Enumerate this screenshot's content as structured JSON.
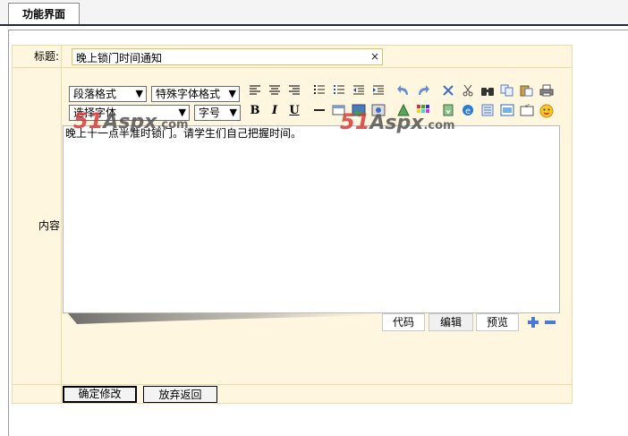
{
  "tab": {
    "label": "功能界面"
  },
  "form": {
    "title_label": "标题:",
    "title_value": "晚上锁门时间通知",
    "content_label": "内容",
    "clear_symbol": "×"
  },
  "toolbar": {
    "paragraph_format": "段落格式",
    "special_font_format": "特殊字体格式",
    "font_select": "选择字体",
    "font_size": "字号",
    "bold": "B",
    "italic": "I",
    "underline": "U"
  },
  "editor": {
    "content": "晚上十一点半准时锁门。请学生们自己把握时间。"
  },
  "mode_tabs": [
    "代码",
    "编辑",
    "预览"
  ],
  "buttons": {
    "confirm": "确定修改",
    "cancel": "放弃返回"
  },
  "watermark": {
    "num": "51",
    "aspx": "Aspx",
    "com": ".com"
  },
  "colors": {
    "form_bg": "#fff6df",
    "form_border": "#efd9a6",
    "watermark_red": "#d93a3a"
  }
}
